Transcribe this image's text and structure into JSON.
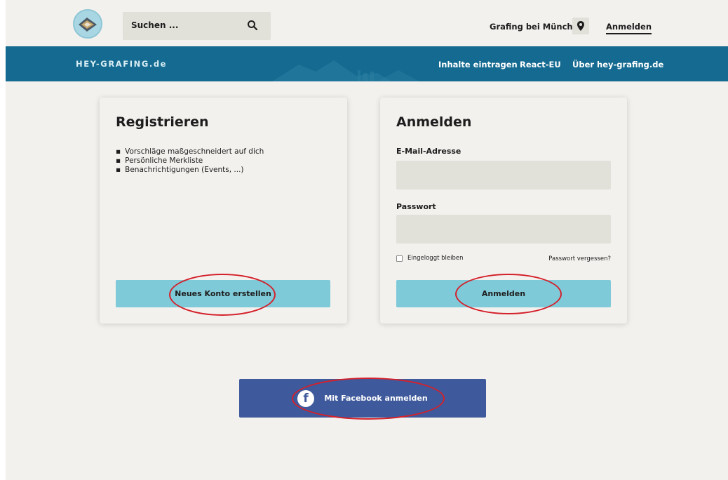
{
  "header": {
    "search_placeholder": "Suchen ...",
    "location": "Grafing bei München",
    "login_link": "Anmelden"
  },
  "nav": {
    "brand": "HEY-GRAFING.de",
    "links": [
      "Inhalte eintragen",
      "React-EU",
      "Über hey-grafing.de"
    ]
  },
  "register": {
    "title": "Registrieren",
    "benefits": [
      "Vorschläge maßgeschneidert auf dich",
      "Persönliche Merkliste",
      "Benachrichtigungen (Events, ...)"
    ],
    "button": "Neues Konto erstellen"
  },
  "login": {
    "title": "Anmelden",
    "email_label": "E-Mail-Adresse",
    "email_value": "",
    "password_label": "Passwort",
    "password_value": "",
    "remember_label": "Eingeloggt bleiben",
    "remember_checked": false,
    "forgot": "Passwort vergessen?",
    "button": "Anmelden"
  },
  "facebook": {
    "button": "Mit Facebook anmelden",
    "icon_glyph": "f"
  },
  "colors": {
    "background": "#f3f1ee",
    "nav_band": "#146a90",
    "accent_button": "#7fcad8",
    "facebook": "#3f5a9c",
    "input": "#e1e0d9",
    "annotation": "#d4202a"
  },
  "icons": [
    "site-logo",
    "search-icon",
    "location-pin-icon",
    "facebook-icon",
    "checkbox"
  ]
}
